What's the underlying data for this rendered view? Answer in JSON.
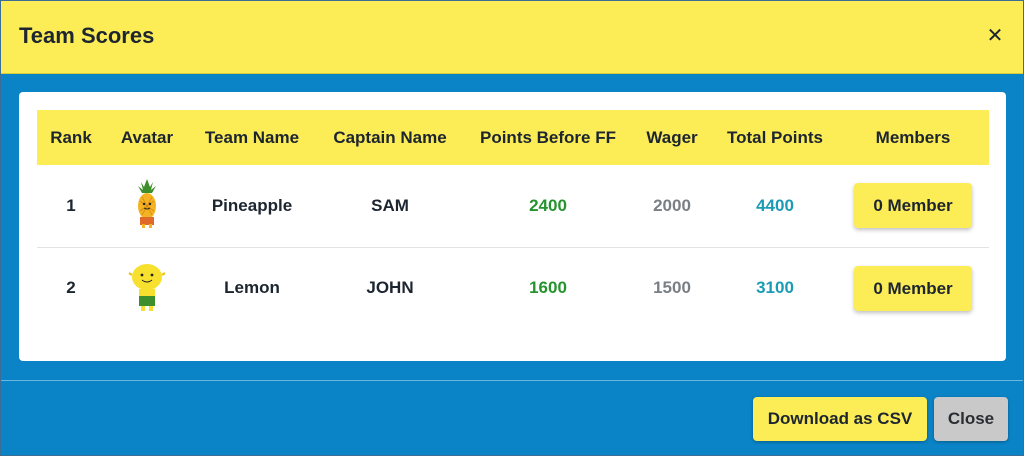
{
  "modal": {
    "title": "Team Scores",
    "close_icon": "close-icon"
  },
  "table": {
    "headers": [
      "Rank",
      "Avatar",
      "Team Name",
      "Captain Name",
      "Points Before FF",
      "Wager",
      "Total Points",
      "Members"
    ],
    "rows": [
      {
        "rank": "1",
        "avatar": "pineapple-avatar",
        "team": "Pineapple",
        "captain": "SAM",
        "points_before_ff": "2400",
        "wager": "2000",
        "total": "4400",
        "members": "0 Member"
      },
      {
        "rank": "2",
        "avatar": "lemon-avatar",
        "team": "Lemon",
        "captain": "JOHN",
        "points_before_ff": "1600",
        "wager": "1500",
        "total": "3100",
        "members": "0 Member"
      }
    ]
  },
  "footer": {
    "download_label": "Download as CSV",
    "close_label": "Close"
  },
  "colors": {
    "header_bg": "#fcec55",
    "modal_bg": "#0a84c6",
    "points_green": "#25942e",
    "total_teal": "#1b9bb5"
  }
}
